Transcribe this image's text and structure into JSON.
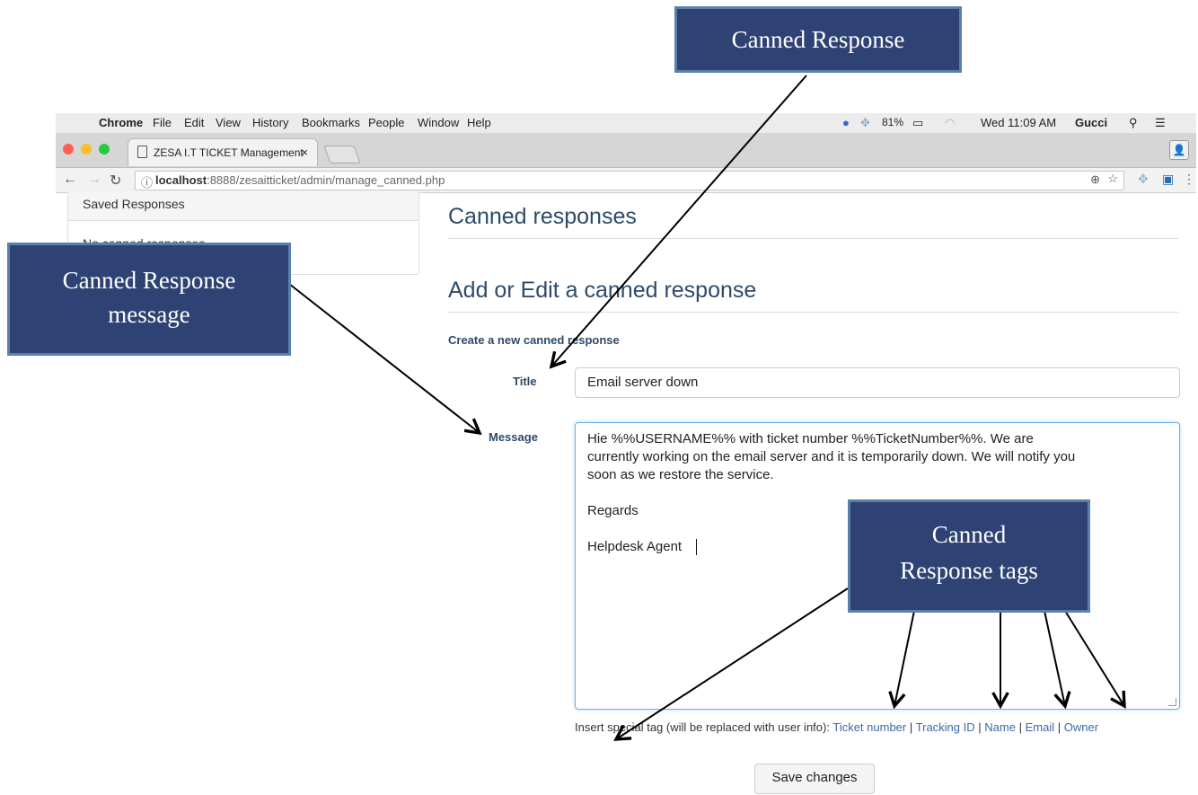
{
  "menubar": {
    "app": "Chrome",
    "items": [
      "File",
      "Edit",
      "View",
      "History",
      "Bookmarks",
      "People",
      "Window",
      "Help"
    ],
    "battery": "81%",
    "clock": "Wed 11:09 AM",
    "user": "Gucci"
  },
  "tab": {
    "title": "ZESA I.T TICKET Management",
    "close": "×"
  },
  "address": {
    "host": "localhost",
    "rest": ":8888/zesaitticket/admin/manage_canned.php"
  },
  "sidebar": {
    "header": "Saved Responses",
    "empty": "No canned responses"
  },
  "main": {
    "heading": "Canned responses",
    "subheading": "Add or Edit a canned response",
    "form_caption": "Create a new canned response",
    "title_label": "Title",
    "title_value": "Email server down",
    "message_label": "Message",
    "message_lines": [
      "Hie %%USERNAME%% with ticket number %%TicketNumber%%. We are",
      "currently working on the email server and it is temporarily down. We will notify you",
      "soon as we restore the service.",
      "Regards",
      "Helpdesk Agent"
    ],
    "tags_prefix": "Insert special tag (will be replaced with user info):",
    "tags": [
      "Ticket number",
      "Tracking ID",
      "Name",
      "Email",
      "Owner"
    ],
    "tag_separator": "|",
    "save_label": "Save changes"
  },
  "callouts": {
    "canned_response": "Canned Response",
    "message_line1": "Canned Response",
    "message_line2": "message",
    "tags_line1": "Canned",
    "tags_line2": "Response tags"
  },
  "colors": {
    "callout_bg": "#2f4274",
    "callout_border": "#5b81ab",
    "link": "#3c6aa6",
    "heading": "#2e4a68"
  },
  "icons": [
    "apple-icon",
    "dropbox-icon",
    "battery-icon",
    "wifi-icon",
    "search-icon",
    "list-icon",
    "page-icon",
    "back-icon",
    "forward-icon",
    "reload-icon",
    "info-icon",
    "zoom-icon",
    "star-icon",
    "profile-icon"
  ]
}
